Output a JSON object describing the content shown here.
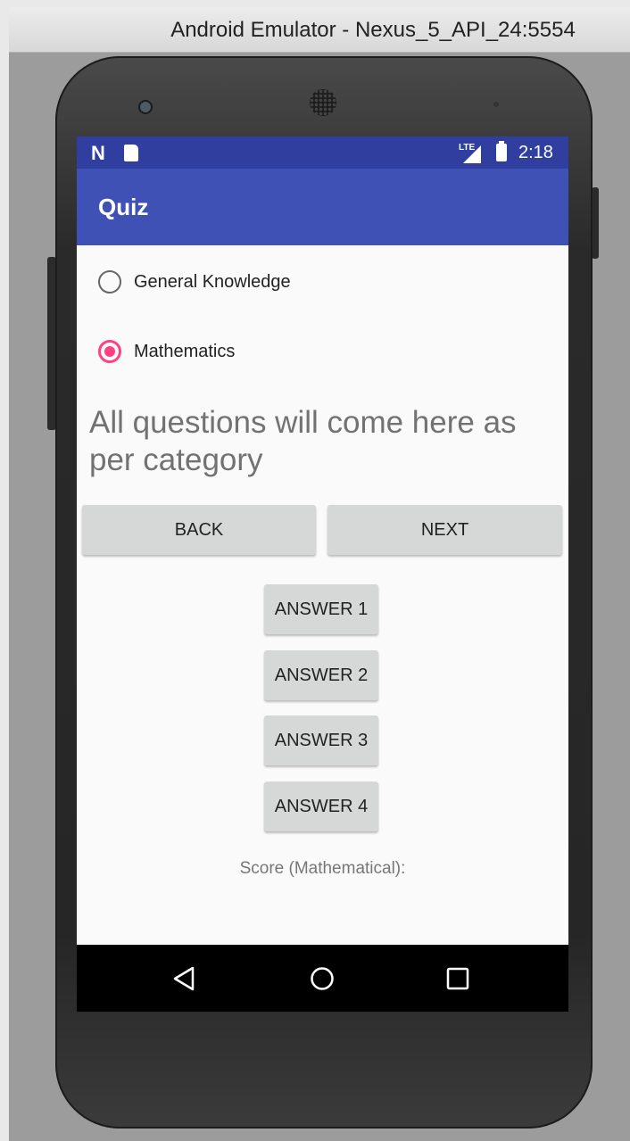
{
  "window": {
    "title": "Android Emulator - Nexus_5_API_24:5554"
  },
  "statusbar": {
    "network": "LTE",
    "time": "2:18",
    "notification_icons": [
      "n-icon",
      "sd-card-icon"
    ]
  },
  "toolbar": {
    "title": "Quiz"
  },
  "categories": [
    {
      "label": "General Knowledge",
      "checked": false
    },
    {
      "label": "Mathematics",
      "checked": true
    }
  ],
  "question": {
    "text": "All questions will come here as per category"
  },
  "nav_buttons": {
    "back": "BACK",
    "next": "NEXT"
  },
  "answers": [
    "ANSWER 1",
    "ANSWER 2",
    "ANSWER 3",
    "ANSWER 4"
  ],
  "score": {
    "label": "Score (Mathematical):"
  },
  "colors": {
    "primary": "#3f51b5",
    "primary_dark": "#303f9f",
    "accent": "#ff4081"
  },
  "system_nav": {
    "icons": [
      "back-icon",
      "home-icon",
      "recents-icon"
    ]
  }
}
